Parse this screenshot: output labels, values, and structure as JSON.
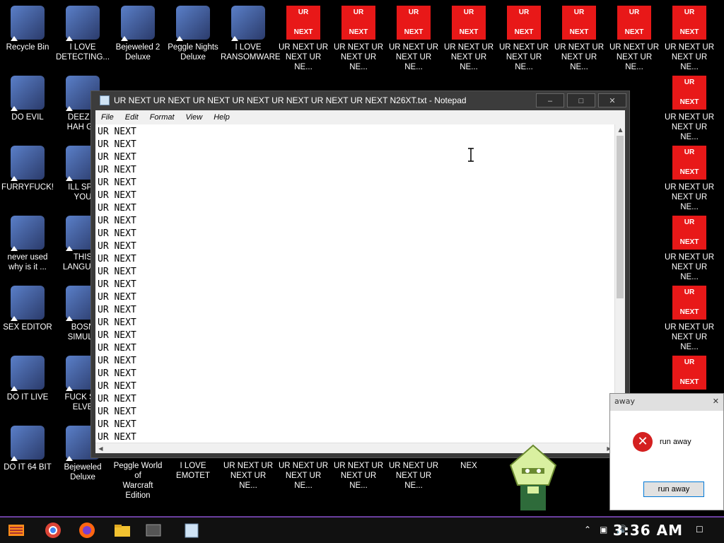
{
  "colors": {
    "desktop_bg": "#000000",
    "ur_tile": "#e81818",
    "taskbar_accent": "#6b3fa0"
  },
  "desktop": {
    "column1": [
      {
        "label": "Recycle Bin",
        "icon": "recycle-bin-icon"
      },
      {
        "label": "DO EVIL",
        "icon": "chrome-icon"
      },
      {
        "label": "FURRYFUCK!",
        "icon": "firefox-icon"
      },
      {
        "label": "never used\nwhy is it ...",
        "icon": "dev-cpp-icon"
      },
      {
        "label": "SEX EDITOR",
        "icon": "hxd-icon"
      },
      {
        "label": "DO IT LIVE",
        "icon": "portrait-icon"
      },
      {
        "label": "DO IT 64 BIT",
        "icon": "portrait-64-icon"
      }
    ],
    "column2": [
      {
        "label": "I LOVE\nDETECTING...",
        "icon": "de-icon"
      },
      {
        "label": "DEEZ N\nHAH GC",
        "icon": "stack-icon"
      },
      {
        "label": "ILL SPY\nYOU",
        "icon": "spy-icon"
      },
      {
        "label": "THIS\nLANGUAG",
        "icon": "go-icon"
      },
      {
        "label": "BOSN\nSIMULA",
        "icon": "virus-icon"
      },
      {
        "label": "FUCK SO\nELVE",
        "icon": "elf-icon"
      },
      {
        "label": "Bejeweled\nDeluxe",
        "icon": "gem-icon"
      }
    ],
    "top_row": [
      {
        "label": "Bejeweled 2\nDeluxe",
        "icon": "bejeweled-2-icon"
      },
      {
        "label": "Peggle Nights\nDeluxe",
        "icon": "peggle-icon"
      },
      {
        "label": "I LOVE\nRANSOMWARE",
        "icon": "publisher-icon"
      }
    ],
    "ur_tile": {
      "top": "UR",
      "bottom": "NEXT"
    },
    "ur_label": "UR NEXT UR\nNEXT UR NE...",
    "bottom_row": [
      {
        "label": "Peggle World of\nWarcraft Edition"
      },
      {
        "label": "I LOVE EMOTET"
      },
      {
        "label": "UR NEXT UR\nNEXT UR NE..."
      },
      {
        "label": "UR NEXT UR\nNEXT UR NE..."
      },
      {
        "label": "UR NEXT UR\nNEXT UR NE..."
      },
      {
        "label": "UR NEXT UR\nNEXT UR NE..."
      },
      {
        "label": "NEX"
      }
    ]
  },
  "notepad": {
    "title": "UR NEXT UR NEXT UR NEXT UR NEXT UR NEXT UR NEXT UR NEXT N26XT.txt - Notepad",
    "menu": [
      "File",
      "Edit",
      "Format",
      "View",
      "Help"
    ],
    "line_text": "UR  NEXT",
    "minimize": "–",
    "maximize": "□",
    "close": "✕"
  },
  "dialog": {
    "title": "away",
    "message": "run away",
    "button": "run away"
  },
  "taskbar": {
    "clock": "3:36 AM"
  }
}
